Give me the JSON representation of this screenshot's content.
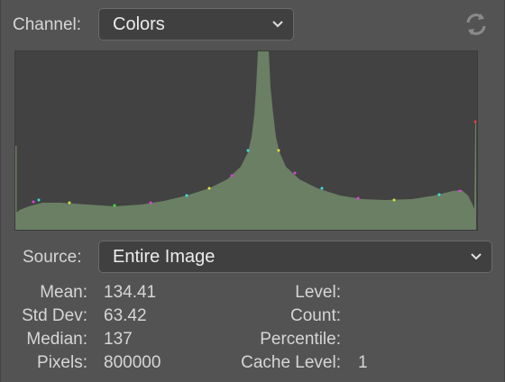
{
  "channel": {
    "label": "Channel:",
    "value": "Colors"
  },
  "source": {
    "label": "Source:",
    "value": "Entire Image"
  },
  "icons": {
    "refresh": "refresh-icon",
    "chevron": "chevron-down-icon"
  },
  "colors": {
    "histogram_fill": "#6a7f64",
    "histogram_bg": "#424242"
  },
  "stats": {
    "mean_label": "Mean:",
    "mean": "134.41",
    "stddev_label": "Std Dev:",
    "stddev": "63.42",
    "median_label": "Median:",
    "median": "137",
    "pixels_label": "Pixels:",
    "pixels": "800000",
    "level_label": "Level:",
    "level": "",
    "count_label": "Count:",
    "count": "",
    "percentile_label": "Percentile:",
    "percentile": "",
    "cache_label": "Cache Level:",
    "cache": "1"
  }
}
